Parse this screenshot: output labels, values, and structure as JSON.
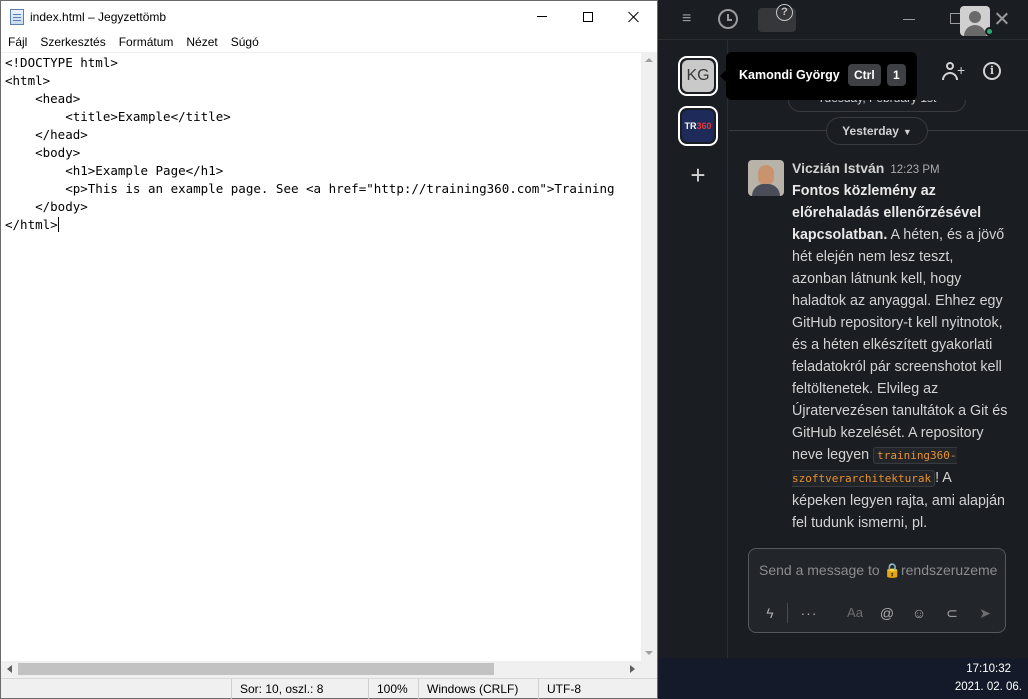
{
  "notepad": {
    "title": "index.html – Jegyzettömb",
    "menu": [
      "Fájl",
      "Szerkesztés",
      "Formátum",
      "Nézet",
      "Súgó"
    ],
    "code_lines": [
      "<!DOCTYPE html>",
      "<html>",
      "    <head>",
      "        <title>Example</title>",
      "    </head>",
      "    <body>",
      "        <h1>Example Page</h1>",
      "        <p>This is an example page. See <a href=\"http://training360.com\">Training",
      "    </body>",
      "</html>"
    ],
    "status": {
      "position": "Sor: 10, oszl.: 8",
      "zoom": "100%",
      "line_ending": "Windows (CRLF)",
      "encoding": "UTF-8"
    }
  },
  "slack": {
    "workspaces": [
      {
        "initials": "KG"
      },
      {
        "initials_a": "TR",
        "initials_b": "360"
      }
    ],
    "tooltip": {
      "name": "Kamondi György",
      "key1": "Ctrl",
      "key2": "1"
    },
    "partial_divider": "Tuesday, February 1st",
    "date_divider": "Yesterday",
    "message": {
      "author": "Viczián István",
      "time": "12:23 PM",
      "bold_text": "Fontos közlemény az előrehaladás ellenőrzésével kapcsolatban.",
      "text_before_code": " A héten, és a jövő hét elején nem lesz teszt, azonban látnunk kell, hogy haladtok az anyaggal. Ehhez egy GitHub repository-t kell nyitnotok, és a héten elkészített gyakorlati feladatokról pár screenshotot kell feltöltenetek. Elvileg az Újratervezésen tanultátok a Git és GitHub kezelését. A repository neve legyen ",
      "code": "training360-szoftverarchitekturak",
      "text_after_code": "! A képeken legyen rajta, ami alapján fel tudunk ismerni, pl."
    },
    "composer": {
      "placeholder": "Send a message to 🔒rendszeruzemeltetes"
    }
  },
  "taskbar": {
    "time": "17:10:32",
    "date": "2021. 02. 06."
  }
}
